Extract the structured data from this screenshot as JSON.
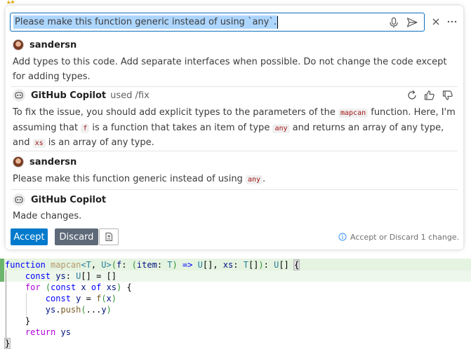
{
  "chat": {
    "input": {
      "value": "Please make this function generic instead of using `any`.",
      "placeholder": ""
    },
    "icons": {
      "mic": "microphone-icon",
      "send": "send-icon",
      "close": "close-icon",
      "more": "more-icon"
    },
    "messages": [
      {
        "author": "sandersn",
        "text": "Add types to this code. Add separate interfaces when possible. Do not change the code except for adding types."
      },
      {
        "author": "GitHub Copilot",
        "used": "used /fix",
        "parts": {
          "p1": "To fix the issue, you should add explicit types to the parameters of the ",
          "c1": "mapcan",
          "p2": " function. Here, I'm assuming that ",
          "c2": "f",
          "p3": " is a function that takes an item of type ",
          "c3": "any",
          "p4": " and returns an array of any type, and ",
          "c4": "xs",
          "p5": " is an array of any type."
        }
      },
      {
        "author": "sandersn",
        "parts": {
          "p1": "Please make this function generic instead of using ",
          "c1": "any",
          "p2": "."
        }
      },
      {
        "author": "GitHub Copilot",
        "text": "Made changes."
      }
    ],
    "actions": {
      "accept": "Accept",
      "discard": "Discard",
      "status": "Accept or Discard 1 change."
    }
  },
  "editor": {
    "lines": [
      "function mapcan<T, U>(f: (item: T) => U[], xs: T[]): U[] {",
      "    const ys: U[] = []",
      "    for (const x of xs) {",
      "        const y = f(x)",
      "        ys.push(...y)",
      "    }",
      "    return ys",
      "}"
    ]
  },
  "colors": {
    "accent": "#007acc",
    "discard": "#5f6a79",
    "added_line": "#e5f3e1",
    "inline_code": "#a31515"
  }
}
